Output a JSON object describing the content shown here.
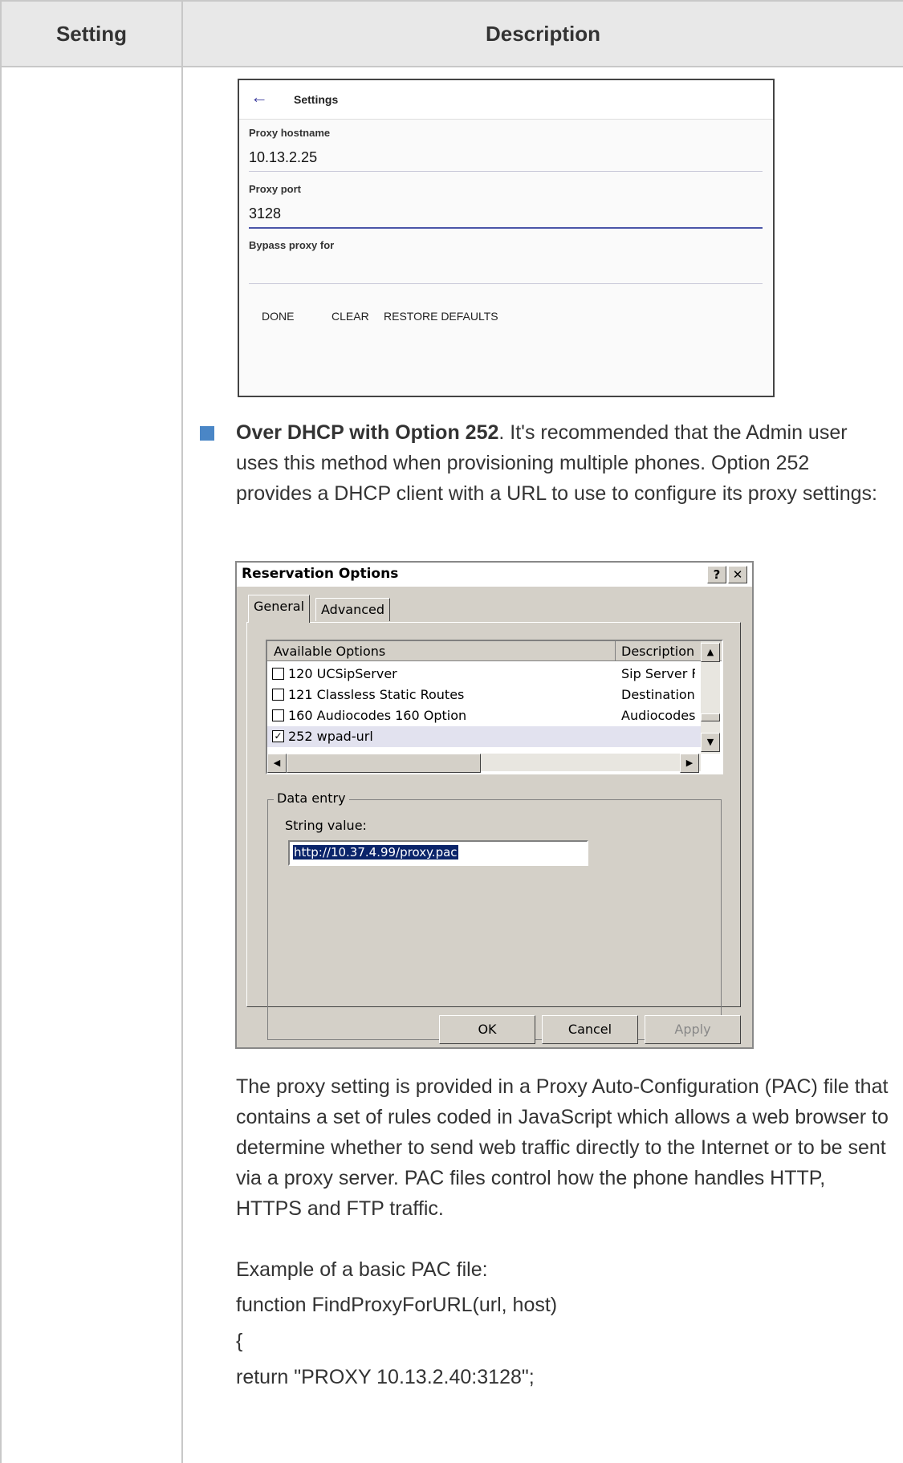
{
  "table": {
    "header_setting": "Setting",
    "header_description": "Description"
  },
  "phone_settings": {
    "back_icon": "arrow-left-icon",
    "title": "Settings",
    "proxy_hostname_label": "Proxy hostname",
    "proxy_hostname_value": "10.13.2.25",
    "proxy_port_label": "Proxy port",
    "proxy_port_value": "3128",
    "bypass_label": "Bypass proxy for",
    "bypass_value": "",
    "buttons": {
      "done": "DONE",
      "clear": "CLEAR",
      "restore": "RESTORE DEFAULTS"
    }
  },
  "bullet": {
    "bold": "Over DHCP with Option 252",
    "text": ". It's recommended that the Admin user uses this method when provisioning multiple phones. Option 252 provides a DHCP client with a URL to use to configure its proxy settings:"
  },
  "dialog": {
    "title": "Reservation Options",
    "help_button": "?",
    "close_button": "✕",
    "tabs": [
      "General",
      "Advanced"
    ],
    "list_header": {
      "col1": "Available Options",
      "col2": "Description"
    },
    "rows": [
      {
        "name": "120 UCSipServer",
        "desc": "Sip Server F",
        "checked": false
      },
      {
        "name": "121 Classless Static Routes",
        "desc": "Destination,",
        "checked": false
      },
      {
        "name": "160 Audiocodes 160 Option",
        "desc": "Audiocodes",
        "checked": false
      },
      {
        "name": "252 wpad-url",
        "desc": "",
        "checked": true
      }
    ],
    "group_label": "Data entry",
    "string_value_label": "String value:",
    "string_value": "http://10.37.4.99/proxy.pac",
    "buttons": {
      "ok": "OK",
      "cancel": "Cancel",
      "apply": "Apply"
    }
  },
  "body_text": {
    "para": "The proxy setting is provided in a Proxy Auto-Configuration (PAC) file that contains a set of rules coded in JavaScript which allows a web browser to determine whether to send web traffic directly to the Internet or to be sent via a proxy server. PAC files control how the phone handles HTTP, HTTPS and FTP traffic.",
    "example": "Example of a basic PAC file:",
    "code1": "function FindProxyForURL(url, host)",
    "code2": "{",
    "code3": "return \"PROXY 10.13.2.40:3128\";"
  }
}
